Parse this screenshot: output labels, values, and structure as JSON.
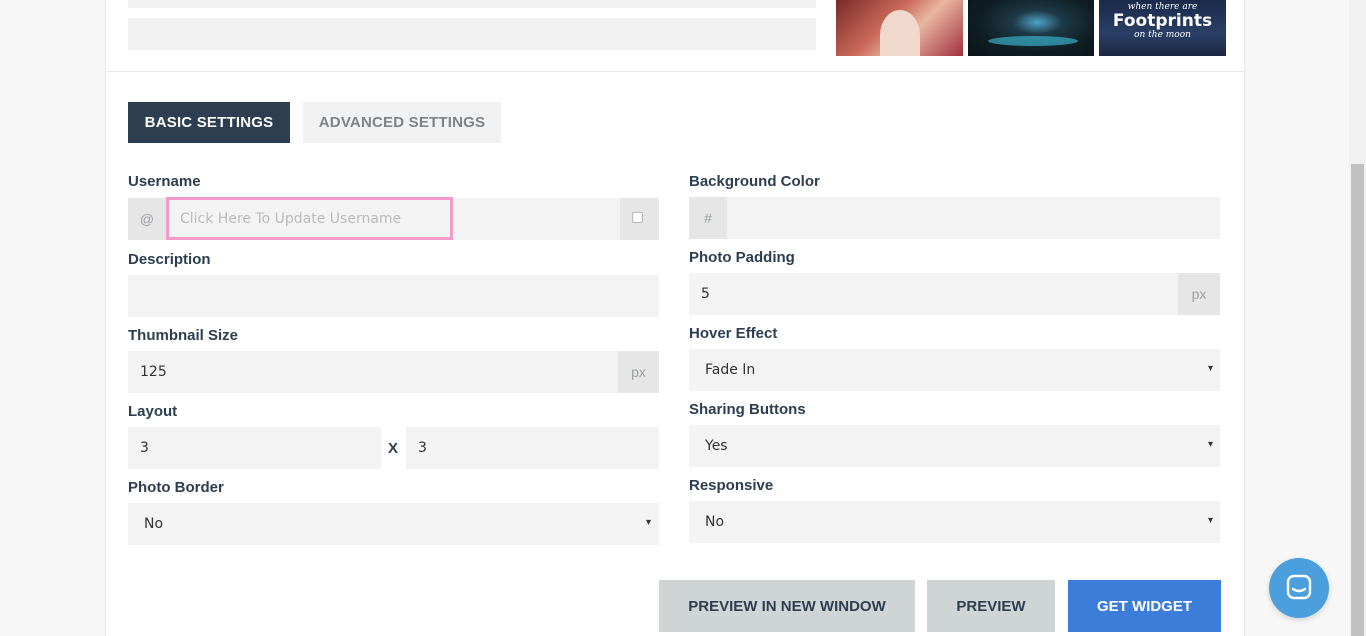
{
  "thumbnails": {
    "third_line1": "when there are",
    "third_line2": "Footprints",
    "third_line3": "on the moon"
  },
  "tabs": {
    "basic": "BASIC SETTINGS",
    "advanced": "ADVANCED SETTINGS"
  },
  "left": {
    "username_label": "Username",
    "username_prefix": "@",
    "username_placeholder": "Click Here To Update Username",
    "description_label": "Description",
    "description_value": "",
    "thumbnail_label": "Thumbnail Size",
    "thumbnail_value": "125",
    "thumbnail_unit": "px",
    "layout_label": "Layout",
    "layout_cols": "3",
    "layout_sep": "X",
    "layout_rows": "3",
    "border_label": "Photo Border",
    "border_value": "No"
  },
  "right": {
    "bg_label": "Background Color",
    "bg_prefix": "#",
    "bg_value": "",
    "padding_label": "Photo Padding",
    "padding_value": "5",
    "padding_unit": "px",
    "hover_label": "Hover Effect",
    "hover_value": "Fade In",
    "sharing_label": "Sharing Buttons",
    "sharing_value": "Yes",
    "responsive_label": "Responsive",
    "responsive_value": "No"
  },
  "buttons": {
    "preview_new_window": "PREVIEW IN NEW WINDOW",
    "preview": "PREVIEW",
    "get_widget": "GET WIDGET"
  },
  "icons": {
    "select_arrow": "▾",
    "chat": "chat-icon"
  }
}
